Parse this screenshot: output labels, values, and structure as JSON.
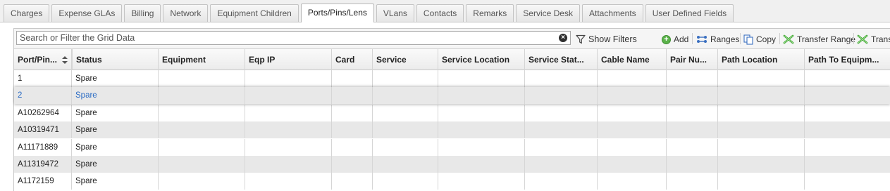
{
  "tabs": [
    {
      "label": "Charges"
    },
    {
      "label": "Expense GLAs"
    },
    {
      "label": "Billing"
    },
    {
      "label": "Network"
    },
    {
      "label": "Equipment Children"
    },
    {
      "label": "Ports/Pins/Lens",
      "active": true
    },
    {
      "label": "VLans"
    },
    {
      "label": "Contacts"
    },
    {
      "label": "Remarks"
    },
    {
      "label": "Service Desk"
    },
    {
      "label": "Attachments"
    },
    {
      "label": "User Defined Fields"
    }
  ],
  "toolbar": {
    "search_placeholder": "Search or Filter the Grid Data",
    "show_filters": "Show Filters",
    "add": "Add",
    "ranges": "Ranges",
    "copy": "Copy",
    "transfer_range": "Transfer Range",
    "transfer": "Trans"
  },
  "grid": {
    "columns": [
      "Port/Pin...",
      "Status",
      "Equipment",
      "Eqp IP",
      "Card",
      "Service",
      "Service Location",
      "Service Stat...",
      "Cable Name",
      "Pair Nu...",
      "Path Location",
      "Path To Equipm..."
    ],
    "rows": [
      {
        "port": "1",
        "status": "Spare"
      },
      {
        "port": "2",
        "status": "Spare",
        "selected": true
      },
      {
        "port": "A10262964",
        "status": "Spare"
      },
      {
        "port": "A10319471",
        "status": "Spare"
      },
      {
        "port": "A11171889",
        "status": "Spare"
      },
      {
        "port": "A11319472",
        "status": "Spare"
      },
      {
        "port": "A1172159",
        "status": "Spare"
      }
    ]
  },
  "colors": {
    "selected_text": "#2b6cc4",
    "alt_row": "#e8e8e8",
    "add_icon": "#5bb24a",
    "transfer_icon": "#3aa52c"
  }
}
